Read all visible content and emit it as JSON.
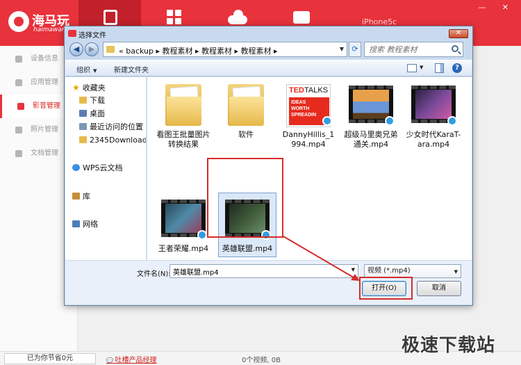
{
  "app": {
    "logo_text": "海马玩",
    "logo_sub": "haimawan",
    "device_name": "iPhone5c",
    "window_buttons": "— ✕"
  },
  "sidebar": {
    "items": [
      {
        "label": "设备信息"
      },
      {
        "label": "应用管理"
      },
      {
        "label": "影音管理"
      },
      {
        "label": "照片管理"
      },
      {
        "label": "文档管理"
      }
    ]
  },
  "dialog": {
    "title": "选择文件",
    "close": "✕",
    "breadcrumb": "« backup ▸ 教程素材 ▸ 教程素材 ▸ 教程素材 ▸",
    "search_placeholder": "搜索 教程素材",
    "toolbar": {
      "organize": "组织",
      "new_folder": "新建文件夹",
      "help": "?"
    },
    "tree": [
      {
        "label": "收藏夹",
        "icon": "star-icon"
      },
      {
        "label": "下载",
        "icon": "folder-icon"
      },
      {
        "label": "桌面",
        "icon": "desktop-icon"
      },
      {
        "label": "最近访问的位置",
        "icon": "recent-icon"
      },
      {
        "label": "2345Downloads",
        "icon": "folder-icon"
      },
      {
        "label": "WPS云文档",
        "icon": "cloud-icon"
      },
      {
        "label": "库",
        "icon": "library-icon"
      },
      {
        "label": "网络",
        "icon": "network-icon"
      }
    ],
    "files": [
      {
        "label": "看图王批量图片转换结果",
        "kind": "folder"
      },
      {
        "label": "软件",
        "kind": "folder"
      },
      {
        "label": "DannyHillis_1994.mp4",
        "kind": "ted-video"
      },
      {
        "label": "超级马里奥兄弟通关.mp4",
        "kind": "video"
      },
      {
        "label": "少女时代KaraT-ara.mp4",
        "kind": "video"
      },
      {
        "label": "王者荣耀.mp4",
        "kind": "video"
      },
      {
        "label": "英雄联盟.mp4",
        "kind": "video",
        "selected": true
      }
    ],
    "ted": {
      "logo_red": "TED",
      "logo_black": "TALKS",
      "line1": "IDEAS",
      "line2": "WORTH",
      "line3": "SPREADIN"
    },
    "filename_label": "文件名(N):",
    "filename_value": "英雄联盟.mp4",
    "filetype": "视频 (*.mp4)",
    "open_label": "打开(O)",
    "cancel_label": "取消"
  },
  "footer": {
    "saved": "已为你节省0元",
    "feedback": "吐槽产品经理",
    "video_count": "0个视频, 0B"
  },
  "watermark": "极速下载站"
}
